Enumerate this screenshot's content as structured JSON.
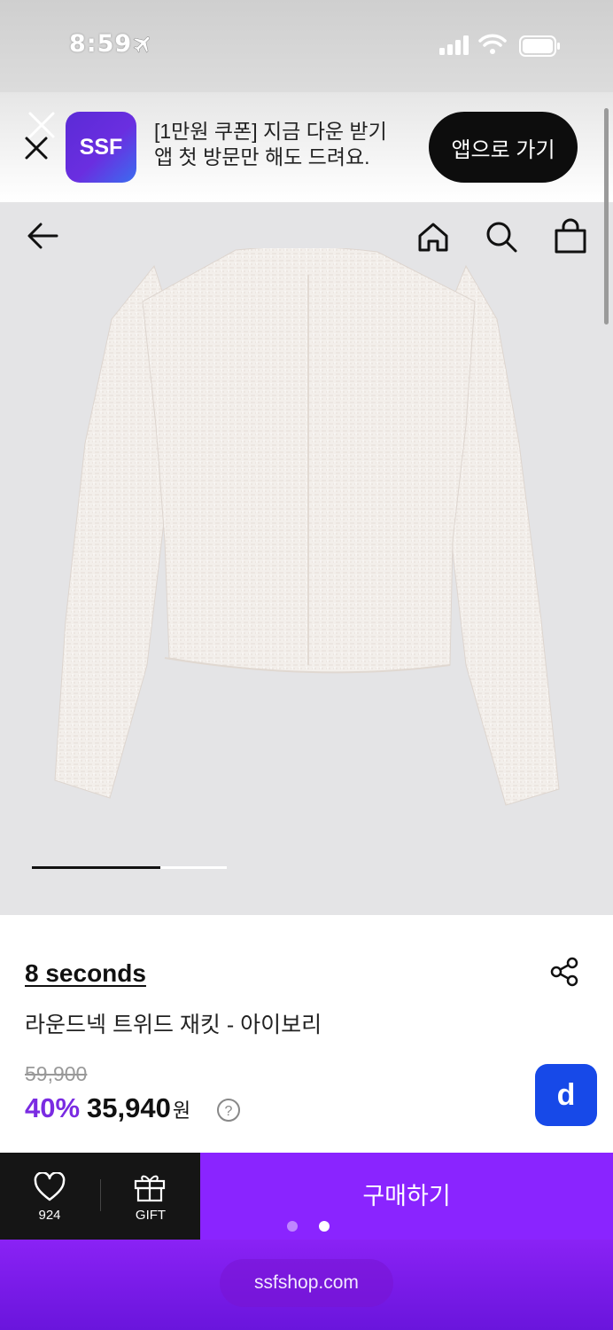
{
  "status_bar": {
    "time": "8:59"
  },
  "banner": {
    "logo_text": "SSF",
    "line1": "[1만원 쿠폰] 지금 다운 받기",
    "line2": "앱 첫 방문만 해도 드려요.",
    "button": "앱으로 가기"
  },
  "carousel": {
    "progress": 0.66
  },
  "product": {
    "brand": "8 seconds",
    "name": "라운드넥 트위드 재킷 - 아이보리",
    "original_price": "59,900",
    "discount": "40%",
    "sale_price": "35,940",
    "currency": "원",
    "badge": "d"
  },
  "actions": {
    "like_count": "924",
    "gift_label": "GIFT",
    "buy_label": "구매하기"
  },
  "browser": {
    "url": "ssfshop.com"
  },
  "colors": {
    "accent": "#8a24ff",
    "discount": "#7a2be2",
    "badge": "#1749e8"
  }
}
